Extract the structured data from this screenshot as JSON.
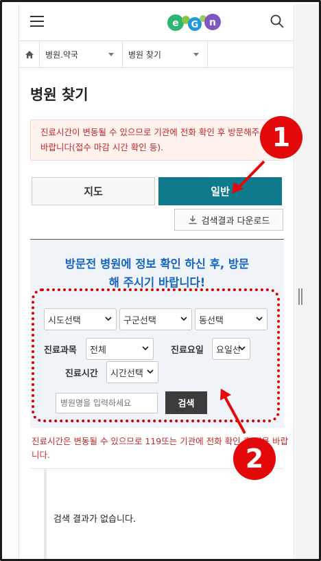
{
  "header": {
    "menu_icon": "hamburger-menu-icon",
    "logo_text": "E-Gen",
    "search_icon": "search-icon"
  },
  "breadcrumb": {
    "home_icon": "home-icon",
    "level1": "병원.약국",
    "level2": "병원 찾기"
  },
  "page_title": "병원 찾기",
  "notice_top": "진료시간이 변동될 수 있으므로 기관에 전화 확인 후 방문해주시기 바랍니다(접수 마감 시간 확인 등).",
  "tabs": {
    "map": "지도",
    "general": "일반"
  },
  "download_label": "검색결과 다운로드",
  "search_panel": {
    "headline_line1": "방문전 병원에 정보 확인 하신 후, 방문",
    "headline_line2": "해 주시기 바랍니다!",
    "sido": "시도선택",
    "sigungu": "구군선택",
    "dong": "동선택",
    "dept_label": "진료과목",
    "dept_value": "전체",
    "day_label": "진료요일",
    "day_value": "요일선",
    "time_label": "진료시간",
    "time_value": "시간선택",
    "name_placeholder": "병원명을 입력하세요",
    "search_button": "검색"
  },
  "notice_bottom": "진료시간은 변동될 수 있으므로 119또는 기관에 전화 확인 후 이용 바랍니다.",
  "empty_result": "검색 결과가 없습니다.",
  "annotations": {
    "badge1": "1",
    "badge2": "2",
    "color": "#e3080a"
  },
  "colors": {
    "accent_teal": "#0f7a8c",
    "headline_blue": "#1565c0",
    "notice_red": "#c62828"
  }
}
